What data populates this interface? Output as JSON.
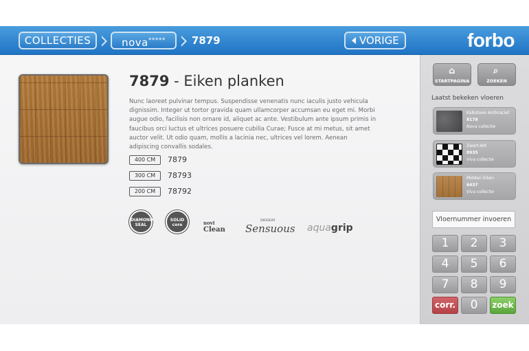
{
  "header": {
    "breadcrumb_collecties": "COLLECTIES",
    "breadcrumb_nova": "nova",
    "breadcrumb_nova_stars": "*****",
    "breadcrumb_current": "7879",
    "back_label": "VORIGE",
    "logo_text": "forbo",
    "accent_color": "#2a7cc8"
  },
  "product": {
    "code": "7879",
    "title_suffix": "- Eiken planken",
    "description": "Nunc laoreet pulvinar tempus. Suspendisse venenatis nunc iaculis justo vehicula dignissim. Integer ut tortor gravida quam ullamcorper accumsan eu eget mi. Morbi augue odio, facilisis non ornare id, aliquet ac ante. Vestibulum ante ipsum primis in faucibus orci luctus et ultrices posuere cubilia Curae; Fusce at mi metus, sit amet auctor velit. Ut odio quam, mollis a lacinia nec, ultrices vel lorem. Aenean adipiscing convallis sodales.",
    "sizes": [
      {
        "badge": "400 CM",
        "code": "7879"
      },
      {
        "badge": "300 CM",
        "code": "78793"
      },
      {
        "badge": "200 CM",
        "code": "78792"
      }
    ],
    "certifications": {
      "diamond_top": "DIAMOND",
      "diamond_bottom": "SEAL",
      "solid_top": "SOLID",
      "solid_bottom": "core",
      "clean_top": "novi",
      "clean_bottom": "Clean",
      "sensuous_small": "DESIGN",
      "sensuous": "Sensuous",
      "aqua": "aqua",
      "grip": "grip"
    }
  },
  "sidebar": {
    "home_label": "STARTPAGINA",
    "search_label": "ZOEKEN",
    "recent_title": "Laatst bekeken vloeren",
    "recent": [
      {
        "name": "Kalksteen Anthraciet",
        "code": "8178",
        "collection": "Nova collectie"
      },
      {
        "name": "Zwart-Wit",
        "code": "8935",
        "collection": "Viva collectie"
      },
      {
        "name": "Midden Eiken",
        "code": "6437",
        "collection": "Viva collectie"
      }
    ],
    "input_placeholder": "Vloernummer invoeren",
    "keys": [
      "1",
      "2",
      "3",
      "4",
      "5",
      "6",
      "7",
      "8",
      "9",
      "corr.",
      "0",
      "zoek"
    ],
    "corr_color": "#b44348",
    "zoek_color": "#5aa53b"
  }
}
